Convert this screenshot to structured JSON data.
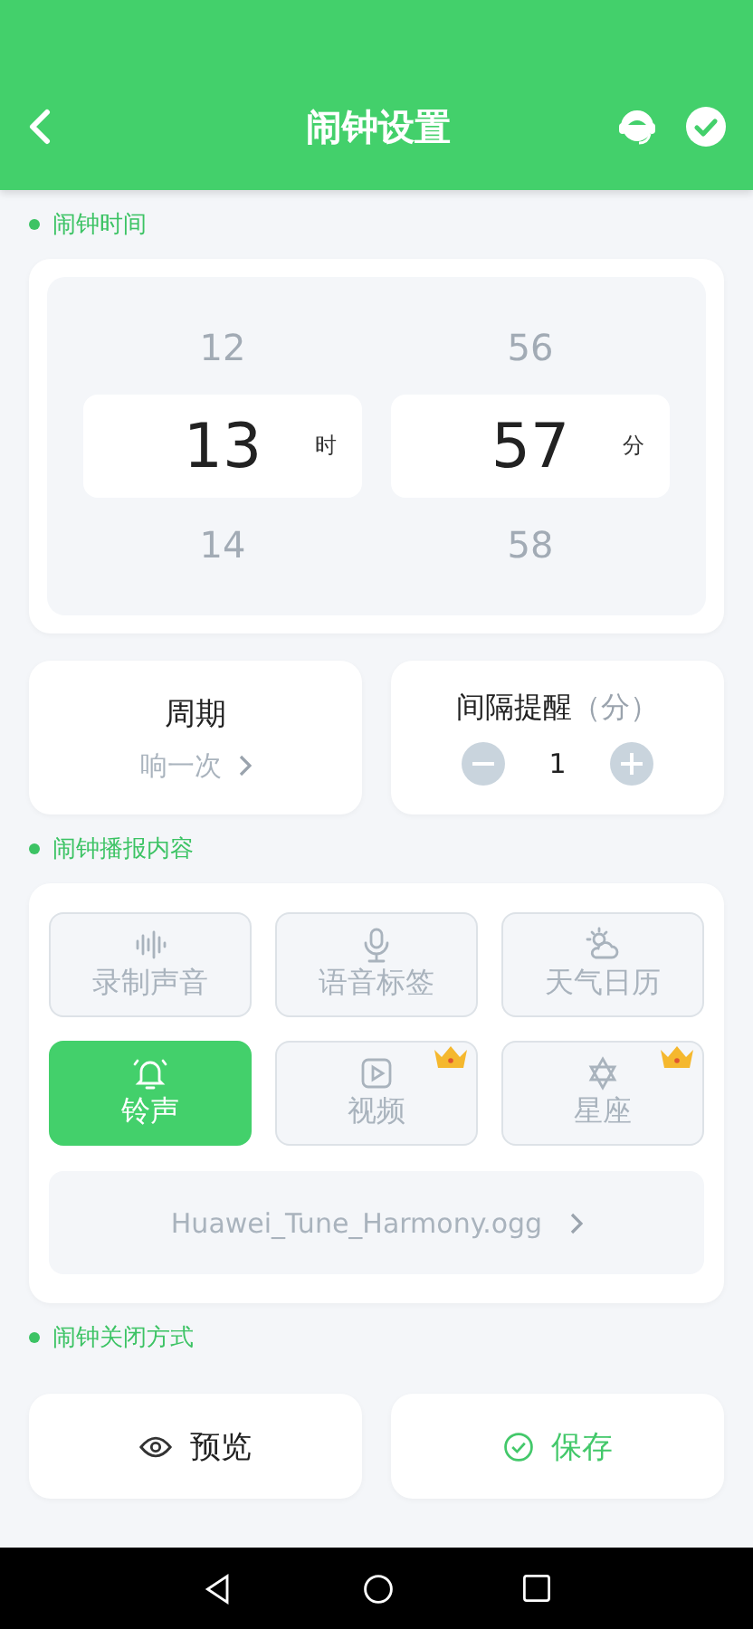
{
  "header": {
    "title": "闹钟设置"
  },
  "sections": [
    {
      "label": "闹钟时间"
    },
    {
      "label": "闹钟播报内容"
    },
    {
      "label": "闹钟关闭方式"
    }
  ],
  "time_picker": [
    {
      "above": "12",
      "value": "13",
      "below": "14",
      "unit": "时"
    },
    {
      "above": "56",
      "value": "57",
      "below": "58",
      "unit": "分"
    }
  ],
  "cycle": {
    "title": "周期",
    "value": "响一次"
  },
  "interval": {
    "title": "间隔提醒",
    "unit": "（分）",
    "value": "1"
  },
  "content_options": [
    {
      "kind": "record",
      "label": "录制声音",
      "selected": false,
      "premium": false
    },
    {
      "kind": "voice",
      "label": "语音标签",
      "selected": false,
      "premium": false
    },
    {
      "kind": "weather",
      "label": "天气日历",
      "selected": false,
      "premium": false
    },
    {
      "kind": "ringtone",
      "label": "铃声",
      "selected": true,
      "premium": false
    },
    {
      "kind": "video",
      "label": "视频",
      "selected": false,
      "premium": true
    },
    {
      "kind": "star",
      "label": "星座",
      "selected": false,
      "premium": true
    }
  ],
  "ringtone_file": "Huawei_Tune_Harmony.ogg",
  "buttons": [
    {
      "kind": "preview",
      "label": "预览"
    },
    {
      "kind": "save",
      "label": "保存"
    }
  ]
}
